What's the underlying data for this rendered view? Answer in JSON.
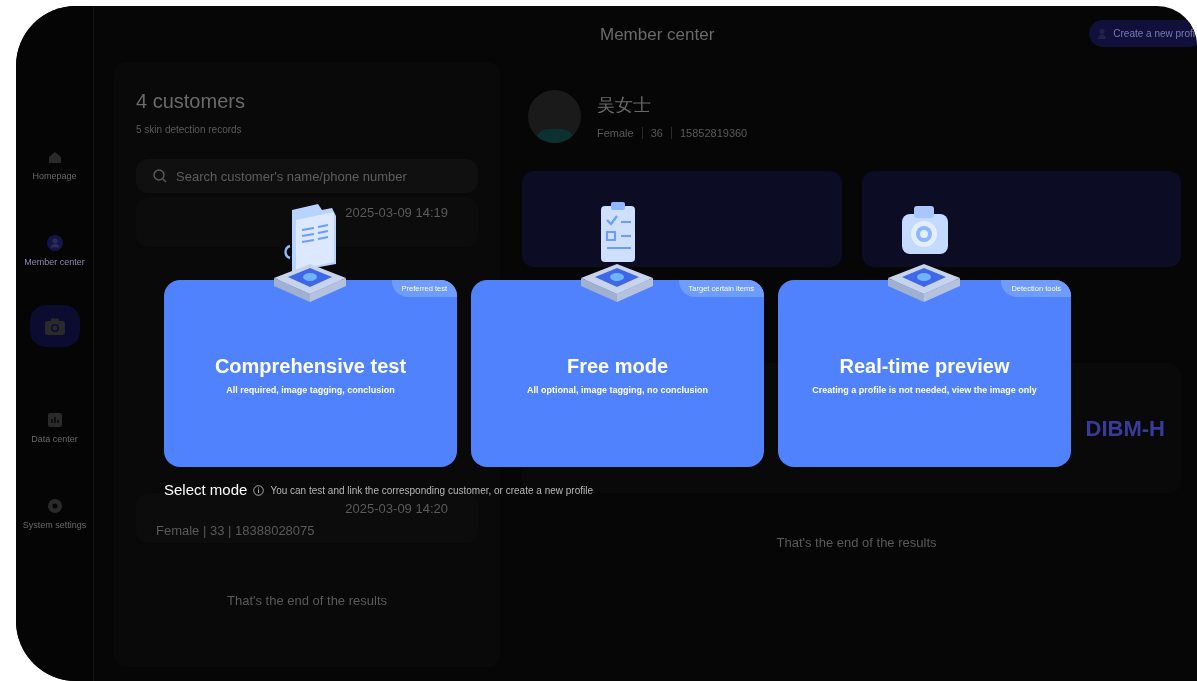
{
  "header": {
    "title": "Member center",
    "create_button": "Create a new profi"
  },
  "sidebar": {
    "items": [
      {
        "kind": "nav",
        "label": "Homepage",
        "selected": false
      },
      {
        "kind": "nav",
        "label": "Member center",
        "selected": true
      },
      {
        "kind": "action"
      },
      {
        "kind": "nav",
        "label": "Data center",
        "selected": false
      },
      {
        "kind": "nav",
        "label": "System settings",
        "selected": false
      }
    ]
  },
  "customers": {
    "title": "4 customers",
    "subtitle": "5 skin detection records",
    "search": {
      "placeholder": "Search customer's name/phone number"
    },
    "rows": [
      {
        "time": "2025-03-09 14:19",
        "selected": false
      },
      {
        "info": "Female | 33 | 18388028075",
        "time": "2025-03-09 14:20",
        "selected": false
      }
    ],
    "end_note": "That's the end of the results"
  },
  "profile": {
    "name": "吴女士",
    "details": [
      "Female",
      "36",
      "15852819360"
    ],
    "device": "DIBM-H",
    "end_note": "That's the end of the results"
  },
  "modal": {
    "title": "Select mode",
    "hint": "You can test and link the corresponding customer, or create a new profile",
    "modes": [
      {
        "kind": "folder",
        "tag": "Preferred test",
        "title": "Comprehensive test",
        "description": "All required, image tagging, conclusion"
      },
      {
        "kind": "clipboard",
        "tag": "Target certain items",
        "title": "Free mode",
        "description": "All optional, image tagging, no conclusion"
      },
      {
        "kind": "camera",
        "tag": "Detection tools",
        "title": "Real-time preview",
        "description": "Creating a profile is not needed, view the image only"
      }
    ]
  }
}
